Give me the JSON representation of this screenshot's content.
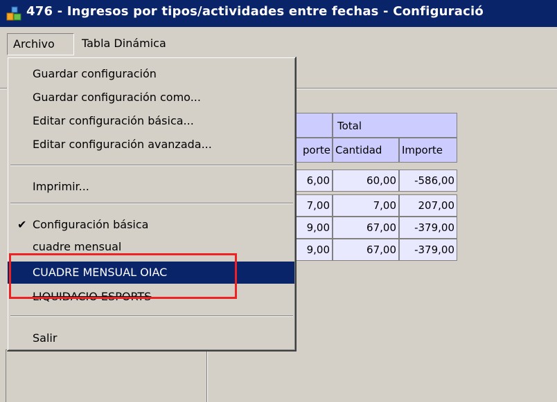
{
  "window": {
    "title": "476 - Ingresos por tipos/actividades entre fechas - Configuració",
    "title_bar_color": "#0a246a"
  },
  "menubar": {
    "items": [
      "Archivo",
      "Tabla Dinámica"
    ]
  },
  "archivo_menu": {
    "items": [
      {
        "label": "Guardar configuración"
      },
      {
        "label": "Guardar configuración como..."
      },
      {
        "label": "Editar configuración básica..."
      },
      {
        "label": "Editar configuración avanzada..."
      },
      {
        "label": "Imprimir..."
      },
      {
        "label": "Configuración básica",
        "checked": true
      },
      {
        "label": "cuadre mensual"
      },
      {
        "label": "CUADRE MENSUAL OIAC",
        "selected": true
      },
      {
        "label": "LIQUIDACIO ESPORTS"
      },
      {
        "label": "Salir"
      }
    ],
    "highlight_color": "#ee2222",
    "selected_color": "#0a246a"
  },
  "pivot": {
    "group_header": "Total",
    "partial_header": "porte",
    "columns": [
      "Cantidad",
      "Importe"
    ],
    "partial_values": [
      "6,00",
      "7,00",
      "9,00",
      "9,00"
    ],
    "rows": [
      {
        "cantidad": "60,00",
        "importe": "-586,00"
      },
      {
        "cantidad": "7,00",
        "importe": "207,00"
      },
      {
        "cantidad": "67,00",
        "importe": "-379,00"
      },
      {
        "cantidad": "67,00",
        "importe": "-379,00"
      }
    ],
    "header_color": "#ccccff",
    "cell_color": "#e8e8ff"
  }
}
